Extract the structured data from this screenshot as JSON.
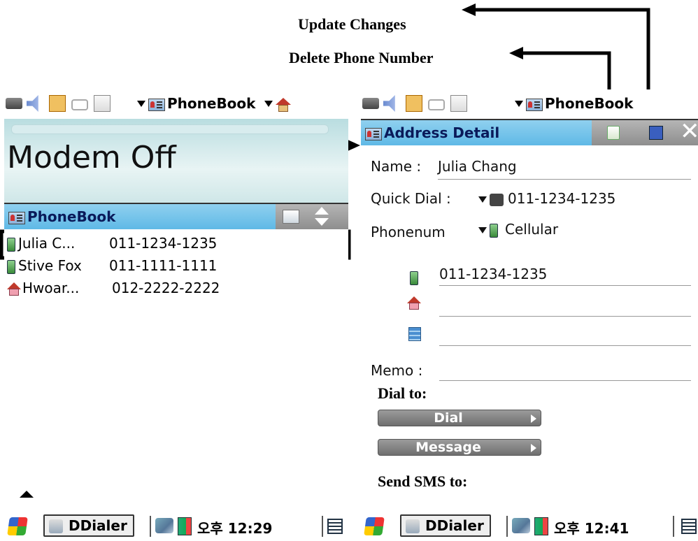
{
  "callouts": {
    "update_changes": "Update Changes",
    "delete_phone_number": "Delete Phone Number"
  },
  "left": {
    "status_app": "PhoneBook",
    "modem_status": "Modem Off",
    "list_title": "PhoneBook",
    "contacts": [
      {
        "name": "Julia C...",
        "number": "011-1234-1235",
        "icon": "cellular-phone-icon"
      },
      {
        "name": "Stive Fox",
        "number": "011-1111-1111",
        "icon": "cellular-phone-icon"
      },
      {
        "name": "Hwoar...",
        "number": "012-2222-2222",
        "icon": "home-icon"
      }
    ],
    "taskbar": {
      "app": "DDialer",
      "clock": "오후 12:29"
    }
  },
  "right": {
    "status_app": "PhoneBook",
    "title": "Address Detail",
    "name_label": "Name :",
    "name_value": "Julia Chang",
    "quick_dial_label": "Quick Dial :",
    "quick_dial_value": "011-1234-1235",
    "phonenum_label": "Phonenum",
    "phonenum_type": "Cellular",
    "numbers": [
      "011-1234-1235",
      "",
      ""
    ],
    "memo_label": "Memo :",
    "dial_to_label": "Dial to:",
    "dial_button": "Dial",
    "message_button": "Message",
    "send_sms_label": "Send SMS to:",
    "taskbar": {
      "app": "DDialer",
      "clock": "오후 12:41"
    }
  }
}
